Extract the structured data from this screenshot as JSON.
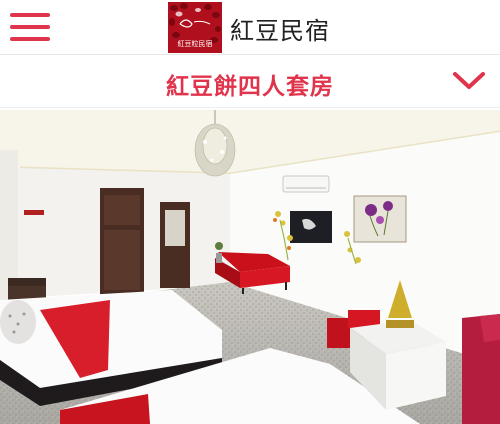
{
  "header": {
    "brand_name": "紅豆民宿",
    "logo_text": "紅豆粒民宿",
    "accent_color": "#e0344c",
    "menu_icon": "hamburger-menu-icon"
  },
  "room": {
    "title": "紅豆餅四人套房",
    "toggle_icon": "chevron-down-icon"
  },
  "photo": {
    "subject": "room-photo"
  }
}
